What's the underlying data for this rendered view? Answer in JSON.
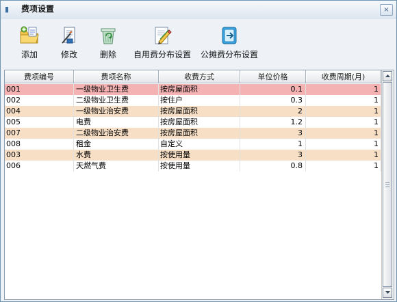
{
  "window": {
    "title": "费项设置",
    "close_glyph": "×"
  },
  "toolbar": {
    "items": [
      {
        "label": "添加",
        "icon": "folder-add-icon"
      },
      {
        "label": "修改",
        "icon": "edit-document-icon"
      },
      {
        "label": "删除",
        "icon": "recycle-bin-icon"
      },
      {
        "label": "自用费分布设置",
        "icon": "pencil-edit-icon"
      },
      {
        "label": "公摊费分布设置",
        "icon": "export-icon"
      }
    ]
  },
  "table": {
    "columns": [
      "费项编号",
      "费项名称",
      "收费方式",
      "单位价格",
      "收费周期(月)"
    ],
    "rows": [
      {
        "code": "001",
        "name": "一级物业卫生费",
        "method": "按房屋面积",
        "price": "0.1",
        "period": "1"
      },
      {
        "code": "002",
        "name": "二级物业卫生费",
        "method": "按住户",
        "price": "0.3",
        "period": "1"
      },
      {
        "code": "004",
        "name": "一级物业治安费",
        "method": "按房屋面积",
        "price": "2",
        "period": "1"
      },
      {
        "code": "005",
        "name": "电费",
        "method": "按房屋面积",
        "price": "1.2",
        "period": "1"
      },
      {
        "code": "007",
        "name": "二级物业治安费",
        "method": "按房屋面积",
        "price": "3",
        "period": "1"
      },
      {
        "code": "008",
        "name": "租金",
        "method": "自定义",
        "price": "1",
        "period": "1"
      },
      {
        "code": "003",
        "name": "水费",
        "method": "按使用量",
        "price": "3",
        "period": "1"
      },
      {
        "code": "006",
        "name": "天燃气费",
        "method": "按使用量",
        "price": "0.8",
        "period": "1"
      }
    ],
    "selected_index": 0
  },
  "colors": {
    "row_alt": "#f7dfc6",
    "row_selected": "#f4b2b3",
    "background": "#eef2f7"
  }
}
